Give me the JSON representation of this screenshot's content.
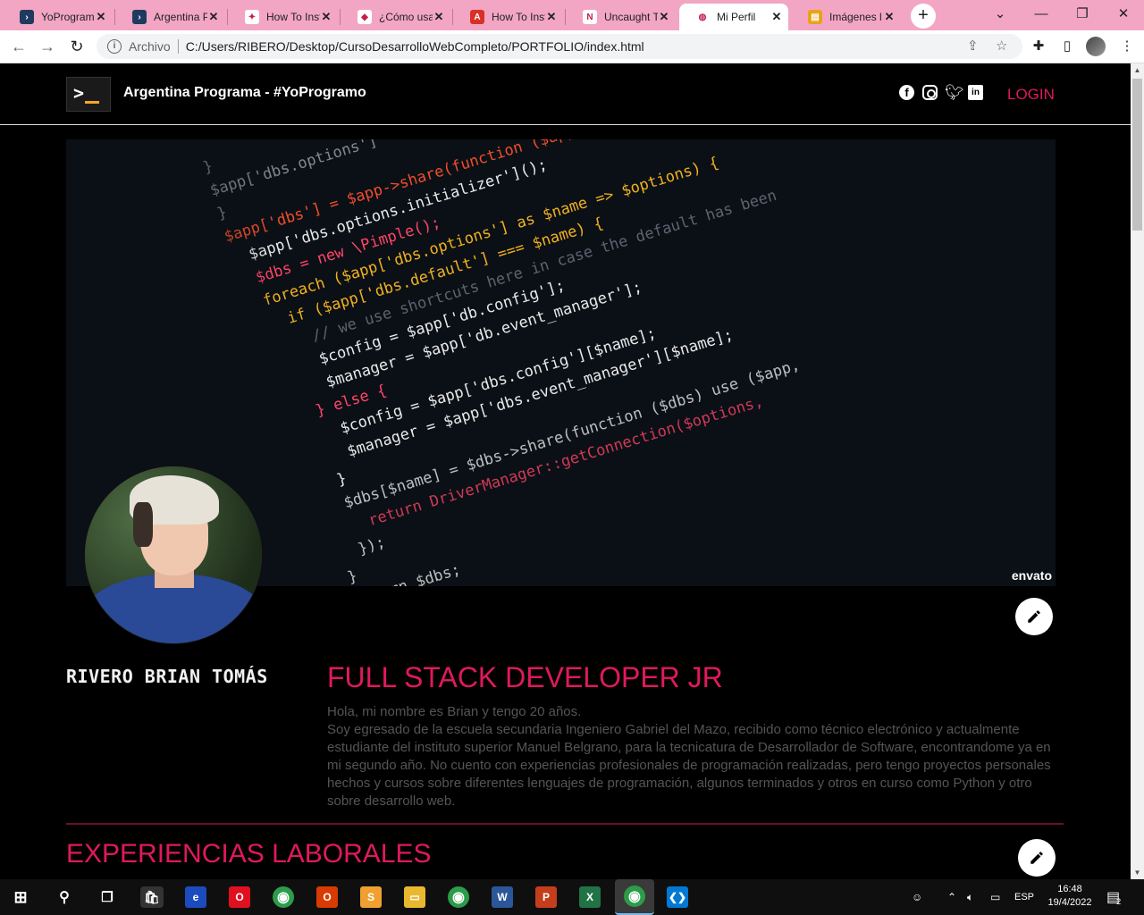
{
  "browser": {
    "tabs": [
      {
        "title": "YoPrograma",
        "favicon": "terminal-favicon",
        "fav_color": "#1e3a5f",
        "fav_glyph": "›"
      },
      {
        "title": "Argentina P",
        "favicon": "terminal-favicon",
        "fav_color": "#1e3a5f",
        "fav_glyph": "›"
      },
      {
        "title": "How To Inst",
        "favicon": "stack-favicon",
        "fav_color": "#ffffff",
        "fav_glyph": "✦"
      },
      {
        "title": "¿Cómo usa",
        "favicon": "diamond-favicon",
        "fav_color": "#ffffff",
        "fav_glyph": "◆"
      },
      {
        "title": "How To Inst",
        "favicon": "pdf-favicon",
        "fav_color": "#d93025",
        "fav_glyph": "A"
      },
      {
        "title": "Uncaught T",
        "favicon": "n-favicon",
        "fav_color": "#ffffff",
        "fav_glyph": "N"
      },
      {
        "title": "Mi Perfil",
        "favicon": "globe-favicon",
        "fav_color": "#ffffff",
        "fav_glyph": "◍"
      },
      {
        "title": "Imágenes l",
        "favicon": "images-favicon",
        "fav_color": "#e8a317",
        "fav_glyph": "▤"
      }
    ],
    "active_tab_index": 6,
    "scheme_label": "Archivo",
    "url": "C:/Users/RIBERO/Desktop/CursoDesarrolloWebCompleto/PORTFOLIO/index.html"
  },
  "site": {
    "brand": "Argentina Programa - #YoProgramo",
    "login": "LOGIN",
    "accent": "#e0195c",
    "social": [
      "facebook-icon",
      "instagram-icon",
      "twitter-icon",
      "linkedin-icon"
    ]
  },
  "banner": {
    "watermark": "envato",
    "code_lines": [
      {
        "text": "}",
        "color": "#d8d8d8"
      },
      {
        "text": "$app['dbs.options'] = $tmp;",
        "color": "#e8e8e8"
      },
      {
        "text": "}",
        "color": "#d8d8d8"
      },
      {
        "text": "$app['dbs'] = $app->share(function ($app) {",
        "color": "#f04d2c"
      },
      {
        "text": "  $app['dbs.options.initializer']();",
        "color": "#e8e8e8"
      },
      {
        "text": "",
        "color": "#e8e8e8"
      },
      {
        "text": "  $dbs = new \\Pimple();",
        "color": "#ff4466"
      },
      {
        "text": "  foreach ($app['dbs.options'] as $name => $options) {",
        "color": "#f0b020"
      },
      {
        "text": "    if ($app['dbs.default'] === $name) {",
        "color": "#f0b020"
      },
      {
        "text": "      // we use shortcuts here in case the default has been",
        "color": "#5a6470"
      },
      {
        "text": "      $config = $app['db.config'];",
        "color": "#e8e8e8"
      },
      {
        "text": "      $manager = $app['db.event_manager'];",
        "color": "#e8e8e8"
      },
      {
        "text": "    } else {",
        "color": "#ff4466"
      },
      {
        "text": "      $config = $app['dbs.config'][$name];",
        "color": "#e8e8e8"
      },
      {
        "text": "      $manager = $app['dbs.event_manager'][$name];",
        "color": "#e8e8e8"
      },
      {
        "text": "    }",
        "color": "#e8e8e8"
      },
      {
        "text": "    $dbs[$name] = $dbs->share(function ($dbs) use ($app,",
        "color": "#e8e8e8"
      },
      {
        "text": "      return DriverManager::getConnection($options,",
        "color": "#ff4466"
      },
      {
        "text": "    });",
        "color": "#e8e8e8"
      },
      {
        "text": "  }",
        "color": "#e8e8e8"
      },
      {
        "text": "  return $dbs;",
        "color": "#e8e8e8"
      }
    ]
  },
  "profile": {
    "name": "RIVERO BRIAN TOMÁS",
    "role": "FULL STACK DEVELOPER JR",
    "bio_line1": "Hola, mi nombre es Brian y tengo 20 años.",
    "bio_line2": "Soy egresado de la escuela secundaria Ingeniero Gabriel del Mazo, recibido como técnico electrónico y actualmente estudiante del instituto superior Manuel Belgrano, para la tecnicatura de Desarrollador de Software, encontrandome ya en mi segundo año. No cuento con experiencias profesionales de programación realizadas, pero tengo proyectos personales hechos y cursos sobre diferentes lenguajes de programación, algunos terminados y otros en curso como Python y otro sobre desarrollo web."
  },
  "sections": {
    "experience_title": "EXPERIENCIAS LABORALES"
  },
  "taskbar": {
    "apps": [
      {
        "name": "edge-legacy-icon",
        "glyph": "e",
        "color": "#1b4bbd"
      },
      {
        "name": "opera-icon",
        "glyph": "O",
        "color": "#e0101e"
      },
      {
        "name": "chrome-icon",
        "glyph": "◉",
        "color": "#2d9c4a"
      },
      {
        "name": "office-icon",
        "glyph": "O",
        "color": "#d83b01"
      },
      {
        "name": "sublime-icon",
        "glyph": "S",
        "color": "#f0a030"
      },
      {
        "name": "file-explorer-icon",
        "glyph": "▭",
        "color": "#e8b92e"
      },
      {
        "name": "chrome-profile-icon",
        "glyph": "◉",
        "color": "#2d9c4a"
      },
      {
        "name": "word-icon",
        "glyph": "W",
        "color": "#2b579a"
      },
      {
        "name": "powerpoint-icon",
        "glyph": "P",
        "color": "#c43e1c"
      },
      {
        "name": "excel-icon",
        "glyph": "X",
        "color": "#217346"
      },
      {
        "name": "chrome-active-icon",
        "glyph": "◉",
        "color": "#2d9c4a"
      },
      {
        "name": "vscode-icon",
        "glyph": "❮❯",
        "color": "#0078d4"
      }
    ],
    "language": "ESP",
    "time": "16:48",
    "date": "19/4/2022",
    "notifications": "2"
  }
}
